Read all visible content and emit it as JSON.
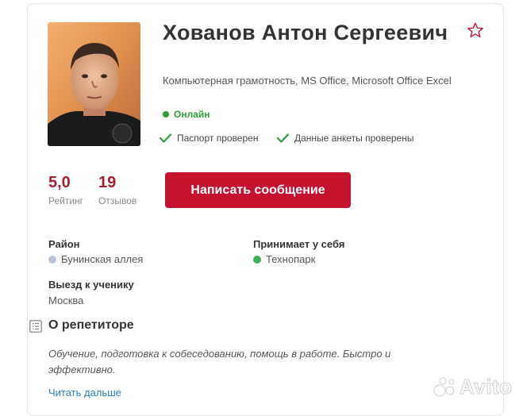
{
  "profile": {
    "name": "Хованов Антон Сергеевич",
    "subjects": "Компьютерная грамотность, MS Office, Microsoft Office Excel",
    "status": "Онлайн",
    "verifications": [
      "Паспорт проверен",
      "Данные анкеты проверены"
    ]
  },
  "stats": {
    "rating_value": "5,0",
    "rating_label": "Рейтинг",
    "reviews_value": "19",
    "reviews_label": "Отзывов"
  },
  "actions": {
    "message_button": "Написать сообщение"
  },
  "details": {
    "district_label": "Район",
    "district_value": "Бунинская аллея",
    "hosts_label": "Принимает у себя",
    "hosts_value": "Технопарк",
    "travel_label": "Выезд к ученику",
    "travel_value": "Москва"
  },
  "about": {
    "title": "О репетиторе",
    "text": "Обучение, подготовка к собеседованию, помощь в работе. Быстро и эффективно.",
    "read_more": "Читать дальше"
  },
  "watermark": "Avito",
  "colors": {
    "accent": "#c4122f",
    "rating": "#a5202f",
    "online": "#2e9e3a",
    "link": "#2b7fc3",
    "district_dot": "#b9c4dc",
    "hosts_dot": "#3cb35a"
  },
  "icons": [
    "star-outline-icon",
    "checkmark-icon",
    "list-icon",
    "avito-logo-icon"
  ]
}
